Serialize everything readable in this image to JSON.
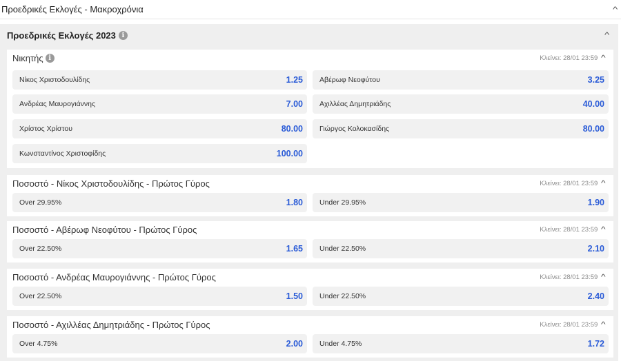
{
  "top_header": {
    "title": "Προεδρικές Εκλογές - Μακροχρόνια",
    "chevron": "chevron-up-icon"
  },
  "event": {
    "title": "Προεδρικές Εκλογές 2023",
    "info": "i"
  },
  "colors": {
    "odds": "#2a5bd7",
    "panel_bg": "#efefef",
    "selection_bg": "#f1f1f1"
  },
  "markets": [
    {
      "title": "Νικητής",
      "closes": "Κλείνει: 28/01 23:59",
      "selections": [
        {
          "name": "Νίκος Χριστοδουλίδης",
          "odds": "1.25"
        },
        {
          "name": "Αβέρωφ Νεοφύτου",
          "odds": "3.25"
        },
        {
          "name": "Ανδρέας Μαυρογιάννης",
          "odds": "7.00"
        },
        {
          "name": "Αχιλλέας Δημητριάδης",
          "odds": "40.00"
        },
        {
          "name": "Χρίστος Χρίστου",
          "odds": "80.00"
        },
        {
          "name": "Γιώργος Κολοκασίδης",
          "odds": "80.00"
        },
        {
          "name": "Κωνσταντίνος Χριστοφίδης",
          "odds": "100.00"
        }
      ]
    },
    {
      "title": "Ποσοστό - Νίκος Χριστοδουλίδης - Πρώτος Γύρος",
      "closes": "Κλείνει: 28/01 23:59",
      "selections": [
        {
          "name": "Over 29.95%",
          "odds": "1.80"
        },
        {
          "name": "Under 29.95%",
          "odds": "1.90"
        }
      ]
    },
    {
      "title": "Ποσοστό - Αβέρωφ Νεοφύτου - Πρώτος Γύρος",
      "closes": "Κλείνει: 28/01 23:59",
      "selections": [
        {
          "name": "Over 22.50%",
          "odds": "1.65"
        },
        {
          "name": "Under 22.50%",
          "odds": "2.10"
        }
      ]
    },
    {
      "title": "Ποσοστό - Ανδρέας Μαυρογιάννης - Πρώτος Γύρος",
      "closes": "Κλείνει: 28/01 23:59",
      "selections": [
        {
          "name": "Over 22.50%",
          "odds": "1.50"
        },
        {
          "name": "Under 22.50%",
          "odds": "2.40"
        }
      ]
    },
    {
      "title": "Ποσοστό - Αχιλλέας Δημητριάδης - Πρώτος Γύρος",
      "closes": "Κλείνει: 28/01 23:59",
      "selections": [
        {
          "name": "Over 4.75%",
          "odds": "2.00"
        },
        {
          "name": "Under 4.75%",
          "odds": "1.72"
        }
      ]
    }
  ]
}
